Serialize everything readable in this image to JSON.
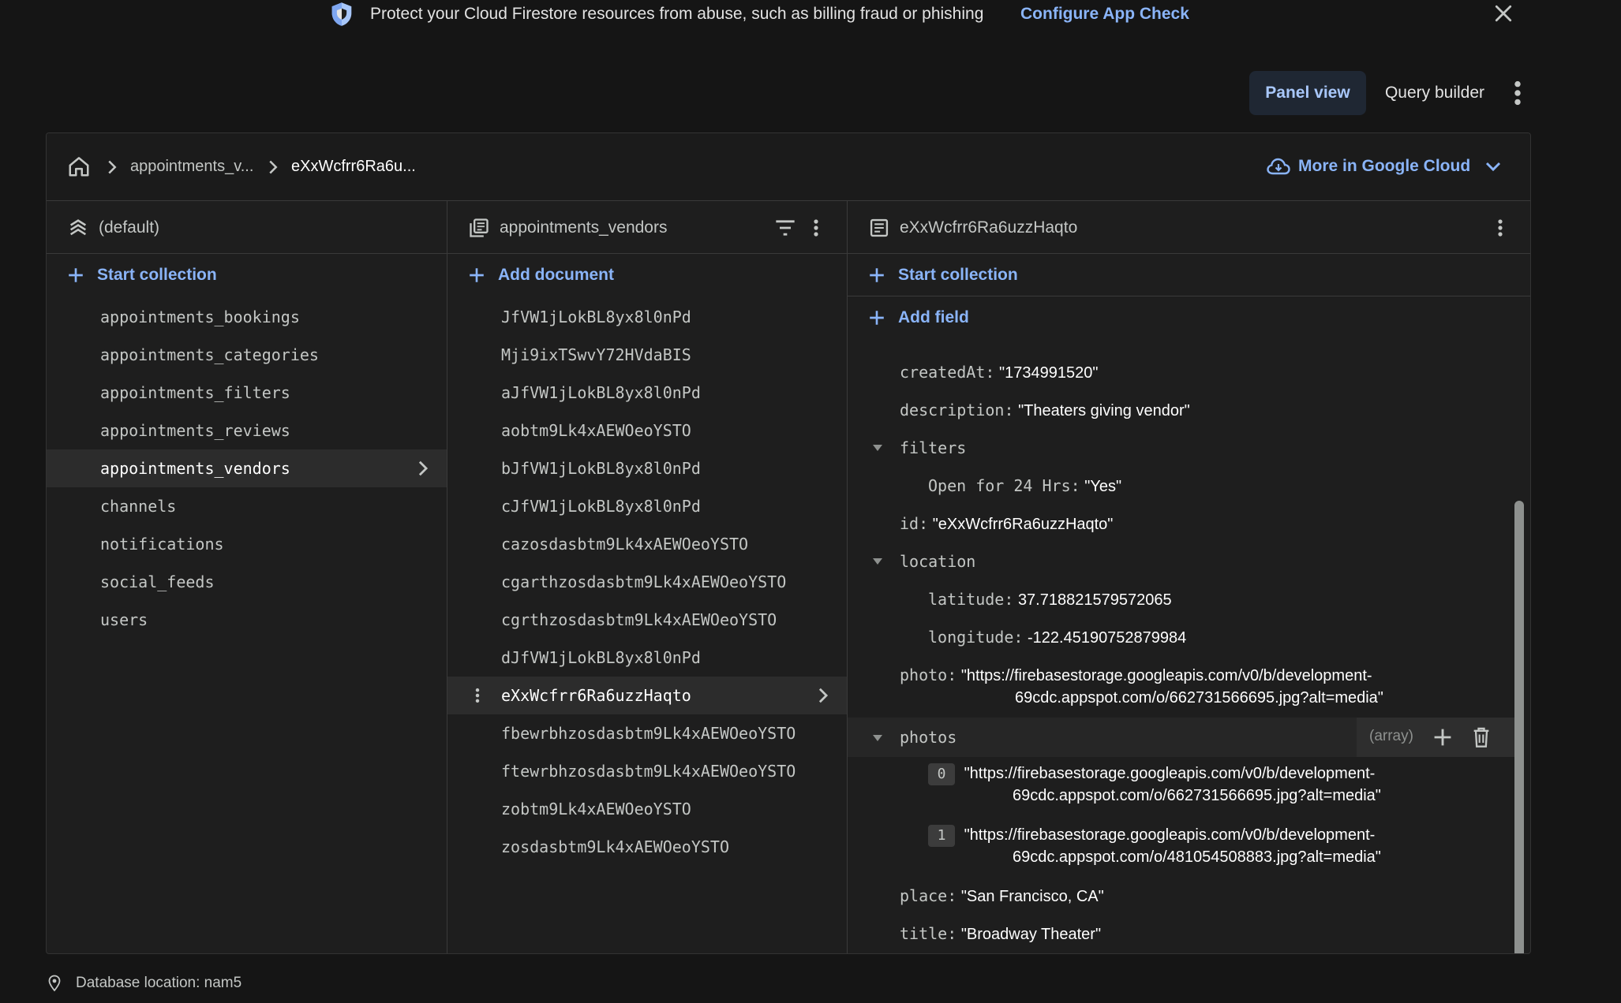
{
  "banner": {
    "message": "Protect your Cloud Firestore resources from abuse, such as billing fraud or phishing",
    "cta": "Configure App Check"
  },
  "toolbar": {
    "panel_view": "Panel view",
    "query_builder": "Query builder"
  },
  "breadcrumb": {
    "items": [
      "appointments_v...",
      "eXxWcfrr6Ra6u..."
    ],
    "more_cloud": "More in Google Cloud"
  },
  "root_column": {
    "title": "(default)",
    "add_label": "Start collection",
    "collections": [
      "appointments_bookings",
      "appointments_categories",
      "appointments_filters",
      "appointments_reviews",
      "appointments_vendors",
      "channels",
      "notifications",
      "social_feeds",
      "users"
    ],
    "selected": "appointments_vendors"
  },
  "collection_column": {
    "title": "appointments_vendors",
    "add_label": "Add document",
    "documents": [
      "JfVW1jLokBL8yx8l0nPd",
      "Mji9ixTSwvY72HVdaBIS",
      "aJfVW1jLokBL8yx8l0nPd",
      "aobtm9Lk4xAEWOeoYSTO",
      "bJfVW1jLokBL8yx8l0nPd",
      "cJfVW1jLokBL8yx8l0nPd",
      "cazosdasbtm9Lk4xAEWOeoYSTO",
      "cgarthzosdasbtm9Lk4xAEWOeoYSTO",
      "cgrthzosdasbtm9Lk4xAEWOeoYSTO",
      "dJfVW1jLokBL8yx8l0nPd",
      "eXxWcfrr6Ra6uzzHaqto",
      "fbewrbhzosdasbtm9Lk4xAEWOeoYSTO",
      "ftewrbhzosdasbtm9Lk4xAEWOeoYSTO",
      "zobtm9Lk4xAEWOeoYSTO",
      "zosdasbtm9Lk4xAEWOeoYSTO"
    ],
    "selected": "eXxWcfrr6Ra6uzzHaqto"
  },
  "document_column": {
    "title": "eXxWcfrr6Ra6uzzHaqto",
    "start_collection": "Start collection",
    "add_field": "Add field",
    "fields": {
      "createdAt": {
        "key": "createdAt:",
        "value": "\"1734991520\""
      },
      "description": {
        "key": "description:",
        "value": "\"Theaters giving vendor\""
      },
      "filters": {
        "key": "filters",
        "open_key": "Open for 24 Hrs:",
        "open_value": "\"Yes\""
      },
      "id": {
        "key": "id:",
        "value": "\"eXxWcfrr6Ra6uzzHaqto\""
      },
      "location": {
        "key": "location",
        "lat_key": "latitude:",
        "lat_value": "37.718821579572065",
        "lng_key": "longitude:",
        "lng_value": "-122.45190752879984"
      },
      "photo": {
        "key": "photo:",
        "value_line1": "\"https://firebasestorage.googleapis.com/v0/b/development-",
        "value_line2": "69cdc.appspot.com/o/662731566695.jpg?alt=media\""
      },
      "photos": {
        "key": "photos",
        "type": "(array)",
        "items": [
          {
            "index": "0",
            "line1": "\"https://firebasestorage.googleapis.com/v0/b/development-",
            "line2": "69cdc.appspot.com/o/662731566695.jpg?alt=media\""
          },
          {
            "index": "1",
            "line1": "\"https://firebasestorage.googleapis.com/v0/b/development-",
            "line2": "69cdc.appspot.com/o/481054508883.jpg?alt=media\""
          }
        ]
      },
      "place": {
        "key": "place:",
        "value": "\"San Francisco, CA\""
      },
      "title": {
        "key": "title:",
        "value": "\"Broadway Theater\""
      }
    }
  },
  "footer": {
    "location": "Database location: nam5"
  },
  "icons": {
    "shield": "shield-icon",
    "close": "close-icon",
    "more": "more-vert-icon",
    "home": "home-icon",
    "cloud": "cloud-icon",
    "database": "database-icon",
    "collection": "collection-icon",
    "document": "document-icon",
    "filter": "filter-icon",
    "plus": "plus-icon",
    "chevron": "chevron-right-icon",
    "delete": "delete-icon",
    "location": "location-pin-icon"
  },
  "colors": {
    "accent": "#8ab4f8",
    "background": "#151515",
    "panel": "#1e1e1e"
  }
}
